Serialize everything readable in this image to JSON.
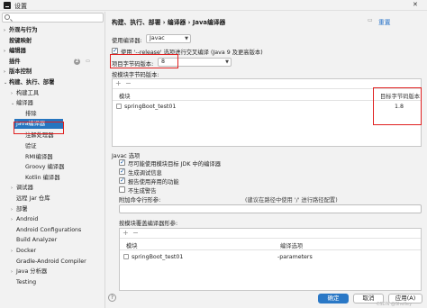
{
  "window": {
    "title": "设置"
  },
  "search": {
    "placeholder": ""
  },
  "sidebar": {
    "items": [
      {
        "label": "外观与行为",
        "level": 0,
        "expand": "›",
        "bold": true
      },
      {
        "label": "按键映射",
        "level": 0,
        "expand": "",
        "bold": true
      },
      {
        "label": "编辑器",
        "level": 0,
        "expand": "›",
        "bold": true
      },
      {
        "label": "插件",
        "level": 0,
        "expand": "",
        "bold": true,
        "badge": "2"
      },
      {
        "label": "版本控制",
        "level": 0,
        "expand": "›",
        "bold": true
      },
      {
        "label": "构建、执行、部署",
        "level": 0,
        "expand": "⌄",
        "bold": true
      },
      {
        "label": "构建工具",
        "level": 1,
        "expand": "›"
      },
      {
        "label": "编译器",
        "level": 1,
        "expand": "⌄"
      },
      {
        "label": "排除",
        "level": 2,
        "expand": ""
      },
      {
        "label": "Java编译器",
        "level": 2,
        "expand": "",
        "selected": true
      },
      {
        "label": "注解处理器",
        "level": 2,
        "expand": ""
      },
      {
        "label": "验证",
        "level": 2,
        "expand": ""
      },
      {
        "label": "RMI编译器",
        "level": 2,
        "expand": ""
      },
      {
        "label": "Groovy 编译器",
        "level": 2,
        "expand": ""
      },
      {
        "label": "Kotlin 编译器",
        "level": 2,
        "expand": ""
      },
      {
        "label": "调试器",
        "level": 1,
        "expand": "›"
      },
      {
        "label": "远程 Jar 仓库",
        "level": 1,
        "expand": ""
      },
      {
        "label": "部署",
        "level": 1,
        "expand": "›"
      },
      {
        "label": "Android",
        "level": 1,
        "expand": "›"
      },
      {
        "label": "Android Configurations",
        "level": 1,
        "expand": ""
      },
      {
        "label": "Build Analyzer",
        "level": 1,
        "expand": ""
      },
      {
        "label": "Docker",
        "level": 1,
        "expand": "›"
      },
      {
        "label": "Gradle-Android Compiler",
        "level": 1,
        "expand": ""
      },
      {
        "label": "Java 分析器",
        "level": 1,
        "expand": "›"
      },
      {
        "label": "Testing",
        "level": 1,
        "expand": ""
      }
    ]
  },
  "breadcrumb": {
    "text": "构建、执行、部署  ›  编译器  ›  Java编译器"
  },
  "reset_label": "重置",
  "compiler": {
    "label": "使用编译器:",
    "value": "Javac"
  },
  "release_option": {
    "label": "使用 '--release' 选项进行交叉编译 (Java 9 及更高版本)",
    "checked": true
  },
  "target_bytecode": {
    "label": "项目字节码版本:",
    "value": "8"
  },
  "per_module_label": "按模块字节码版本:",
  "module_table": {
    "col_module": "模块",
    "col_target": "目标字节码版本",
    "rows": [
      {
        "module": "springBoot_test01",
        "target": "1.8"
      }
    ]
  },
  "javac_options": {
    "title": "Javac 选项",
    "checks": [
      {
        "label": "尽可能使用模块目标 JDK 中的编译器",
        "checked": true
      },
      {
        "label": "生成调试信息",
        "checked": true
      },
      {
        "label": "报告使用弃用的功能",
        "checked": true
      },
      {
        "label": "不生成警告",
        "checked": false
      }
    ],
    "extra_params_label": "附加命令行形参:",
    "extra_params_hint": "(建议在路径中使用 '/' 进行路径配置)"
  },
  "override_label": "按模块覆盖编译器形参:",
  "override_table": {
    "col_module": "模块",
    "col_options": "编译选项",
    "rows": [
      {
        "module": "springBoot_test01",
        "options": "-parameters"
      }
    ]
  },
  "footer": {
    "ok": "确定",
    "cancel": "取消",
    "apply": "应用(A)",
    "help": "?"
  },
  "watermark": "CSDN @Shelley"
}
